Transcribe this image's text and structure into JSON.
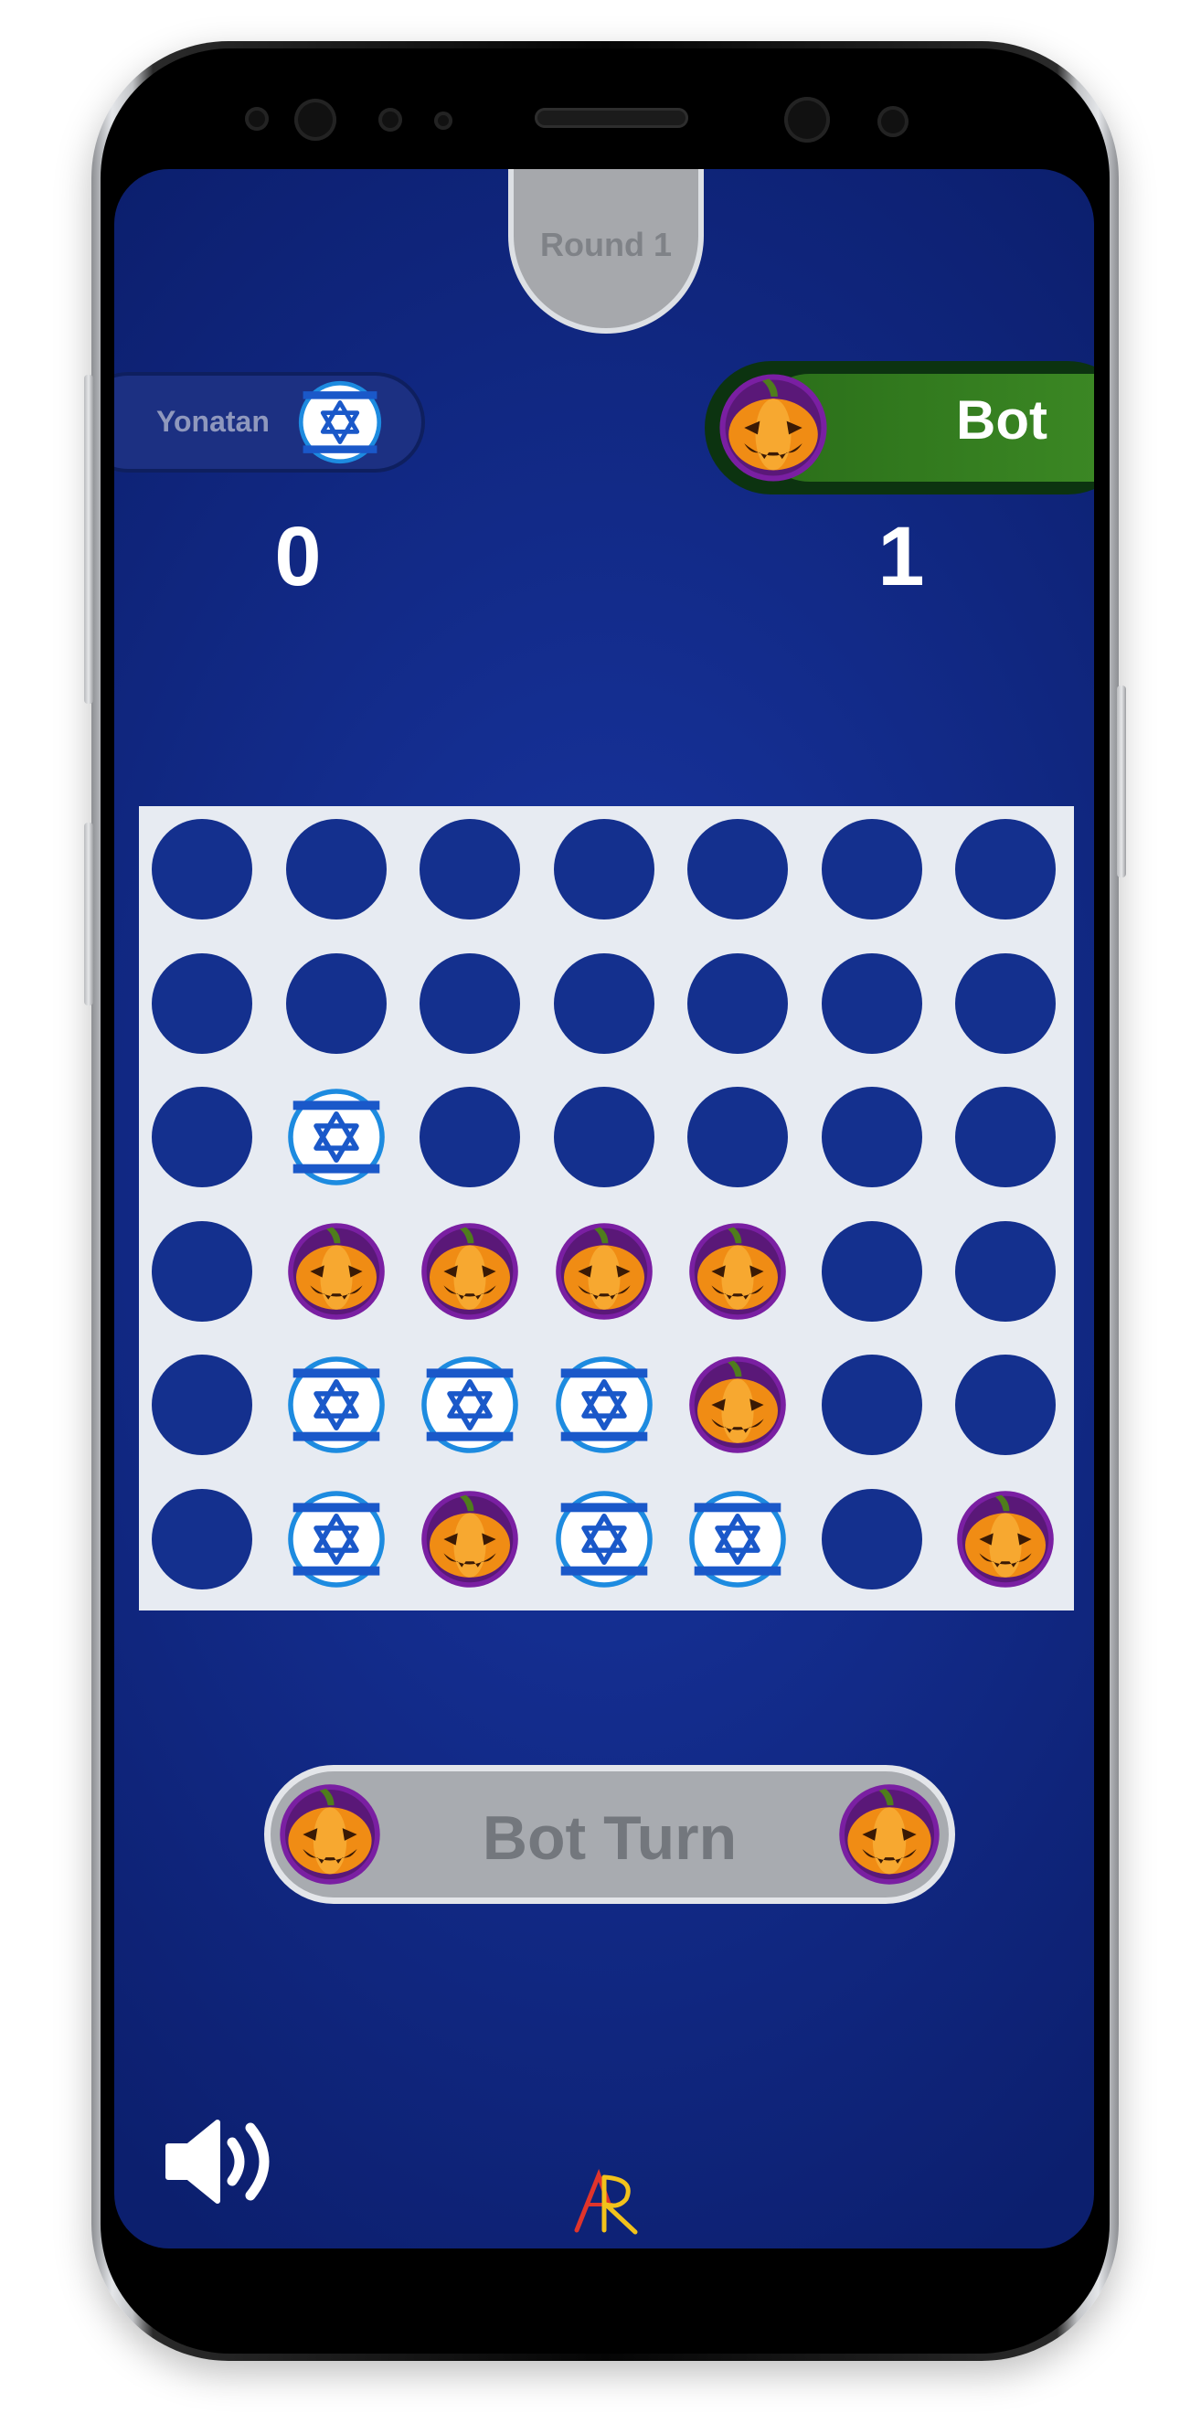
{
  "round": {
    "label": "Round 1"
  },
  "players": {
    "left": {
      "name": "Yonatan",
      "score": "0",
      "piece": "flag"
    },
    "right": {
      "name": "Bot",
      "score": "1",
      "piece": "pumpkin"
    }
  },
  "status": {
    "label": "Bot Turn"
  },
  "board": {
    "columns": 7,
    "rows": 6,
    "cells": [
      [
        "empty",
        "empty",
        "empty",
        "empty",
        "empty",
        "empty",
        "empty"
      ],
      [
        "empty",
        "empty",
        "empty",
        "empty",
        "empty",
        "empty",
        "empty"
      ],
      [
        "empty",
        "flag",
        "empty",
        "empty",
        "empty",
        "empty",
        "empty"
      ],
      [
        "empty",
        "pumpkin",
        "pumpkin",
        "pumpkin",
        "pumpkin",
        "empty",
        "empty"
      ],
      [
        "empty",
        "flag",
        "flag",
        "flag",
        "pumpkin",
        "empty",
        "empty"
      ],
      [
        "empty",
        "flag",
        "pumpkin",
        "flag",
        "flag",
        "empty",
        "pumpkin"
      ]
    ]
  },
  "icons": {
    "sound": "speaker-volume-icon",
    "logo": "ar-logo-icon",
    "flag_piece": "israel-flag-icon",
    "bot_piece": "pumpkin-icon"
  },
  "colors": {
    "background": "#132c8c",
    "hole": "#14308e",
    "board": "#e7ebf2",
    "bot_pill": "#3d8a25",
    "status_pill": "#a8abb0"
  }
}
